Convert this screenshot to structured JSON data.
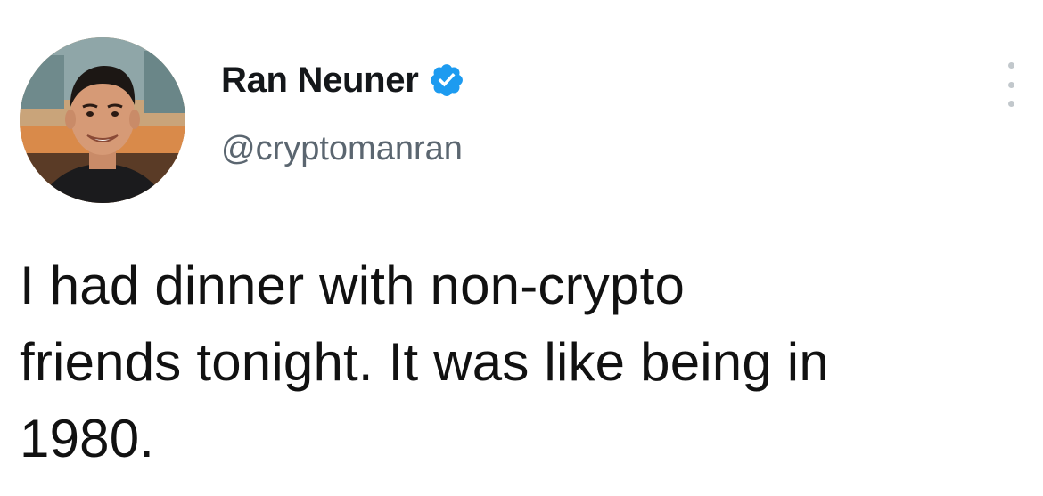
{
  "author": {
    "display_name": "Ran Neuner",
    "handle": "@cryptomanran",
    "verified": true,
    "avatar_icon": "profile-photo",
    "verified_icon": "verified-badge-icon"
  },
  "tweet": {
    "text": "I had dinner with non-crypto\nfriends tonight. It was like being in\n1980."
  },
  "menu": {
    "icon": "more-options-icon"
  },
  "colors": {
    "verified_blue": "#1d9bf0",
    "name_text": "#14171a",
    "handle_text": "#5b6670",
    "body_text": "#111111"
  }
}
